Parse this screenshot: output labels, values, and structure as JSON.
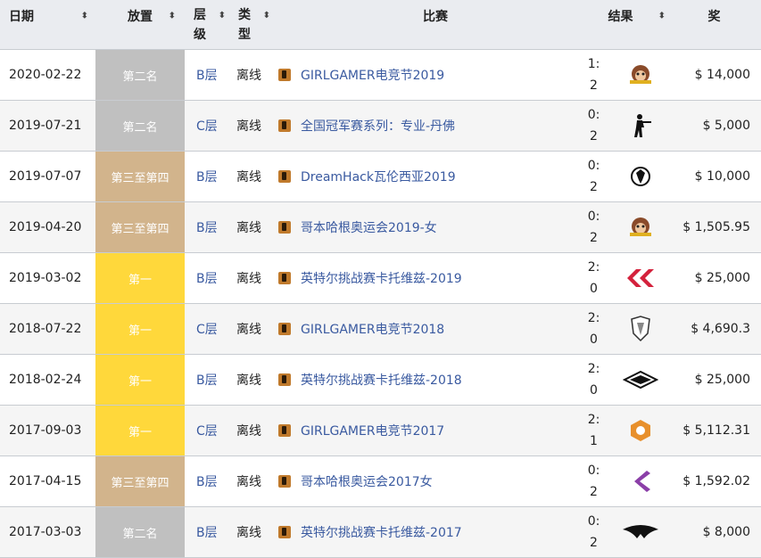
{
  "headers": {
    "date": "日期",
    "place": "放置",
    "tier_a": "层",
    "tier_b": "级",
    "type_a": "类",
    "type_b": "型",
    "event": "比赛",
    "result": "结果",
    "prize": "奖",
    "sort_glyph": "⬍"
  },
  "colors": {
    "second": "#c0c0c0",
    "third_fourth": "#d2b48c",
    "first": "#ffd83b",
    "link": "#3a5aa0",
    "header_bg": "#eaecf0"
  },
  "rows": [
    {
      "date": "2020-02-22",
      "place": "第二名",
      "place_kind": "second",
      "tier": "B层",
      "type": "离线",
      "event": "GIRLGAMER电竞节2019",
      "score_top": "1:",
      "score_bottom": "2",
      "opponent_icon": "monkey-logo-icon",
      "prize": "$ 14,000"
    },
    {
      "date": "2019-07-21",
      "place": "第二名",
      "place_kind": "second",
      "tier": "C层",
      "type": "离线",
      "event": "全国冠军赛系列：专业-丹佛",
      "score_top": "0:",
      "score_bottom": "2",
      "opponent_icon": "soldier-silhouette-icon",
      "prize": "$ 5,000"
    },
    {
      "date": "2019-07-07",
      "place": "第三至第四",
      "place_kind": "third_fourth",
      "tier": "B层",
      "type": "离线",
      "event": "DreamHack瓦伦西亚2019",
      "score_top": "0:",
      "score_bottom": "2",
      "opponent_icon": "eagle-crest-icon",
      "prize": "$ 10,000"
    },
    {
      "date": "2019-04-20",
      "place": "第三至第四",
      "place_kind": "third_fourth",
      "tier": "B层",
      "type": "离线",
      "event": "哥本哈根奥运会2019-女",
      "score_top": "0:",
      "score_bottom": "2",
      "opponent_icon": "monkey-logo-icon",
      "prize": "$ 1,505.95"
    },
    {
      "date": "2019-03-02",
      "place": "第一",
      "place_kind": "first",
      "tier": "B层",
      "type": "离线",
      "event": "英特尔挑战赛卡托维兹-2019",
      "score_top": "2:",
      "score_bottom": "0",
      "opponent_icon": "clg-logo-icon",
      "prize": "$ 25,000"
    },
    {
      "date": "2018-07-22",
      "place": "第一",
      "place_kind": "first",
      "tier": "C层",
      "type": "离线",
      "event": "GIRLGAMER电竞节2018",
      "score_top": "2:",
      "score_bottom": "0",
      "opponent_icon": "shield-logo-icon",
      "prize": "$ 4,690.3"
    },
    {
      "date": "2018-02-24",
      "place": "第一",
      "place_kind": "first",
      "tier": "B层",
      "type": "离线",
      "event": "英特尔挑战赛卡托维兹-2018",
      "score_top": "2:",
      "score_bottom": "0",
      "opponent_icon": "box-logo-icon",
      "prize": "$ 25,000"
    },
    {
      "date": "2017-09-03",
      "place": "第一",
      "place_kind": "first",
      "tier": "C层",
      "type": "离线",
      "event": "GIRLGAMER电竞节2017",
      "score_top": "2:",
      "score_bottom": "1",
      "opponent_icon": "orange-badge-icon",
      "prize": "$ 5,112.31"
    },
    {
      "date": "2017-04-15",
      "place": "第三至第四",
      "place_kind": "third_fourth",
      "tier": "B层",
      "type": "离线",
      "event": "哥本哈根奥运会2017女",
      "score_top": "0:",
      "score_bottom": "2",
      "opponent_icon": "purple-chevron-icon",
      "prize": "$ 1,592.02"
    },
    {
      "date": "2017-03-03",
      "place": "第二名",
      "place_kind": "second",
      "tier": "B层",
      "type": "离线",
      "event": "英特尔挑战赛卡托维兹-2017",
      "score_top": "0:",
      "score_bottom": "2",
      "opponent_icon": "secret-logo-icon",
      "prize": "$ 8,000"
    }
  ]
}
